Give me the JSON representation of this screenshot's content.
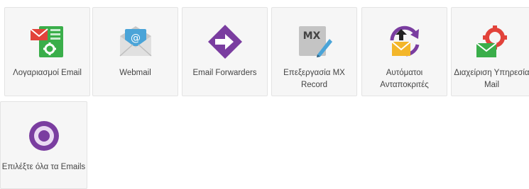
{
  "tiles": [
    {
      "label_line1": "Λογαριασμοί Email",
      "label_line2": "",
      "icon": "email-accounts-icon"
    },
    {
      "label_line1": "Webmail",
      "label_line2": "",
      "icon": "webmail-envelope-icon",
      "icon_text": "@"
    },
    {
      "label_line1": "Email Forwarders",
      "label_line2": "",
      "icon": "forward-arrow-icon"
    },
    {
      "label_line1": "Επεξεργασία MX",
      "label_line2": "Record",
      "icon": "mx-record-edit-icon",
      "icon_text": "MX"
    },
    {
      "label_line1": "Αυτόματοι",
      "label_line2": "Ανταποκριτές",
      "icon": "autoresponder-icon"
    },
    {
      "label_line1": "Διαχείριση Υπηρεσία",
      "label_line2": "Mail",
      "icon": "mail-service-gear-icon"
    },
    {
      "label_line1": "Επιλέξτε όλα τα Emails",
      "label_line2": "",
      "icon": "select-all-radio-icon"
    }
  ],
  "colors": {
    "tile_bg": "#f6f6f6",
    "green": "#3aae4a",
    "red": "#e2433b",
    "purple": "#7a3da0",
    "blue": "#4aa4d8",
    "gray": "#9a9a9a",
    "yellow": "#f3b62a"
  }
}
